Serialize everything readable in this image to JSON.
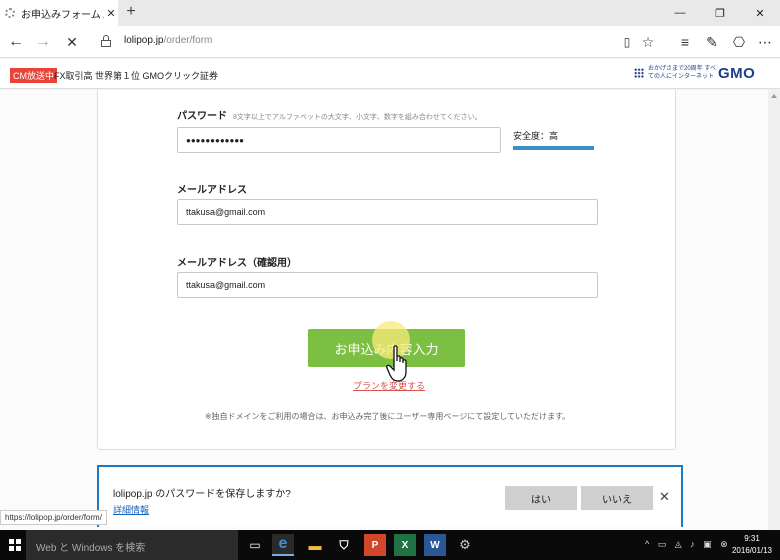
{
  "tab": {
    "title": "お申込みフォーム / お申込",
    "close": "✕",
    "new_tab": "+"
  },
  "window": {
    "minimize": "—",
    "restore": "❐",
    "close": "✕"
  },
  "address": {
    "host": "lolipop.jp",
    "path": "/order/form"
  },
  "ad": {
    "badge": "CM放送中",
    "text": "FX取引高 世界第１位 GMOクリック証券",
    "gmo_tag": "おかげさまで20周年 すべての人にインターネット",
    "gmo_logo": "GMO"
  },
  "form": {
    "password_label": "パスワード",
    "password_hint": "8文字以上でアルファベットの大文字、小文字、数字を組み合わせてください。",
    "password_value": "●●●●●●●●●●●●",
    "strength_label": "安全度：高",
    "email_label": "メールアドレス",
    "email_value": "ttakusa@gmail.com",
    "email_confirm_label": "メールアドレス（確認用）",
    "email_confirm_value": "ttakusa@gmail.com",
    "submit_label": "お申込み内容入力",
    "plan_link": "プランを変更する",
    "note": "※独自ドメインをご利用の場合は、お申込み完了後にユーザー専用ページにて設定していただけます。"
  },
  "save_password": {
    "question": "lolipop.jp のパスワードを保存しますか?",
    "details": "詳細情報",
    "yes": "はい",
    "no": "いいえ",
    "close": "✕"
  },
  "status_url": "https://lolipop.jp/order/form/",
  "taskbar": {
    "search_placeholder": "Web と Windows を検索",
    "time": "9:31",
    "date": "2016/01/13"
  }
}
